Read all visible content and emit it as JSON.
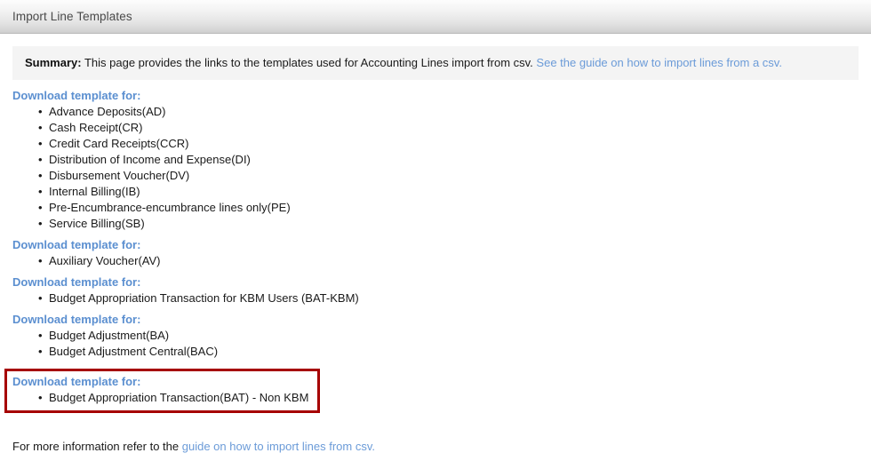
{
  "window": {
    "title": "Import Line Templates"
  },
  "summary": {
    "label": "Summary:",
    "text": " This page provides the links to the templates used for Accounting Lines import from csv. ",
    "link_text": "See the guide on how to import lines from a csv."
  },
  "sections": [
    {
      "heading": "Download template for:",
      "items": [
        "Advance Deposits(AD)",
        "Cash Receipt(CR)",
        "Credit Card Receipts(CCR)",
        "Distribution of Income and Expense(DI)",
        "Disbursement Voucher(DV)",
        "Internal Billing(IB)",
        "Pre-Encumbrance-encumbrance lines only(PE)",
        "Service Billing(SB)"
      ],
      "highlighted": false
    },
    {
      "heading": "Download template for:",
      "items": [
        "Auxiliary Voucher(AV)"
      ],
      "highlighted": false
    },
    {
      "heading": "Download template for:",
      "items": [
        "Budget Appropriation Transaction for KBM Users (BAT-KBM)"
      ],
      "highlighted": false
    },
    {
      "heading": "Download template for:",
      "items": [
        "Budget Adjustment(BA)",
        "Budget Adjustment Central(BAC)"
      ],
      "highlighted": false
    },
    {
      "heading": "Download template for:",
      "items": [
        "Budget Appropriation Transaction(BAT) - Non KBM"
      ],
      "highlighted": true
    }
  ],
  "footer": {
    "prefix": "For more information refer to the ",
    "link_text": "guide on how to import lines from csv."
  },
  "colors": {
    "link": "#6b9bd8",
    "heading": "#5b8fd0",
    "highlight_border": "#a60000",
    "summary_bg": "#f4f4f4"
  },
  "icons": {
    "bullet": "•"
  }
}
